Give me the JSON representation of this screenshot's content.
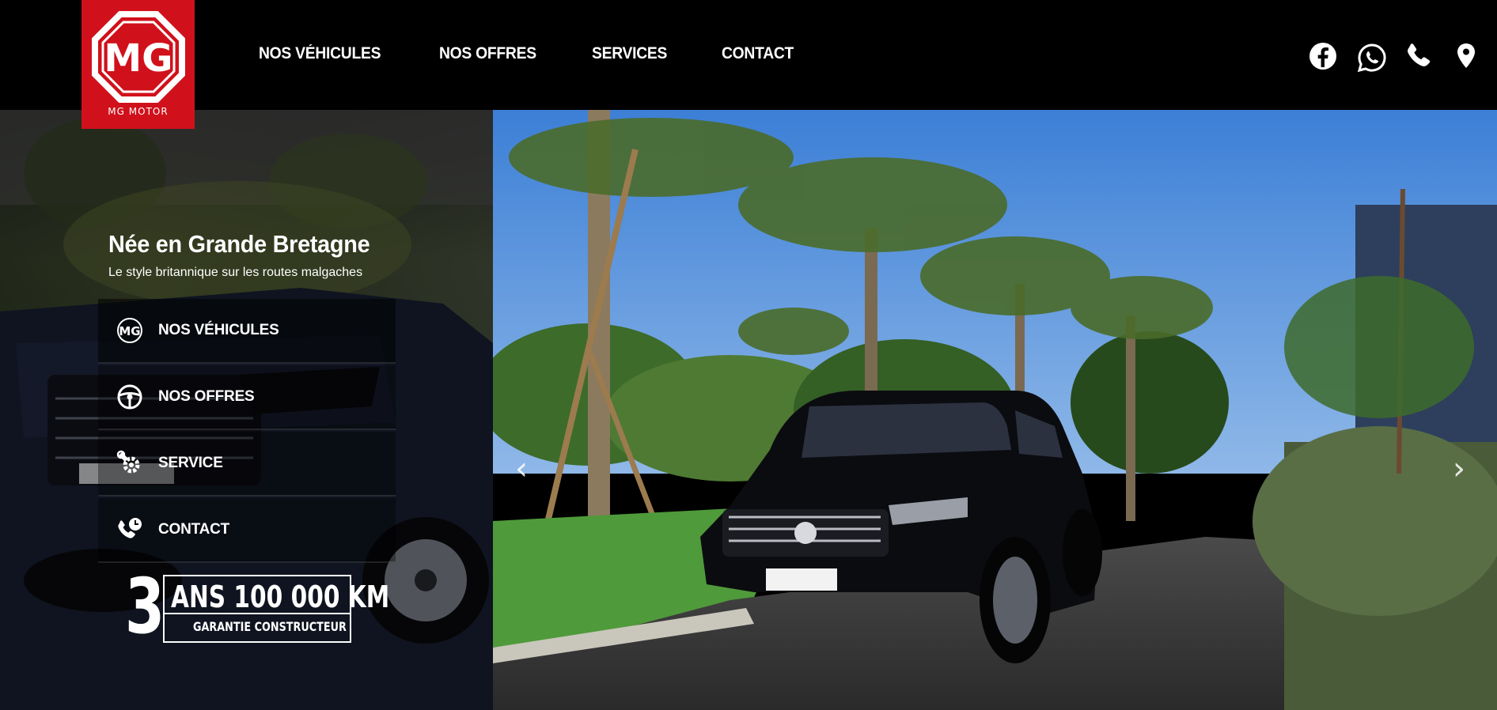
{
  "brand": {
    "name": "MG MOTOR",
    "logo_letters": "MG",
    "color": "#d0111b"
  },
  "nav": {
    "items": [
      {
        "label": "NOS VÉHICULES"
      },
      {
        "label": "NOS OFFRES"
      },
      {
        "label": "SERVICES"
      },
      {
        "label": "CONTACT"
      }
    ]
  },
  "social": [
    "facebook-icon",
    "whatsapp-icon",
    "phone-icon",
    "location-pin-icon"
  ],
  "hero": {
    "headline": "Née en Grande Bretagne",
    "subline": "Le style britannique sur les routes malgaches",
    "menu": [
      {
        "label": "NOS VÉHICULES",
        "icon": "mg-logo-icon"
      },
      {
        "label": "NOS OFFRES",
        "icon": "steering-wheel-icon"
      },
      {
        "label": "SERVICE",
        "icon": "service-gear-icon"
      },
      {
        "label": "CONTACT",
        "icon": "phone-clock-icon"
      }
    ],
    "warranty": {
      "years": "3",
      "line1": "ANS 100 000 KM",
      "line2": "GARANTIE CONSTRUCTEUR"
    }
  },
  "slider": {
    "prev": "‹",
    "next": "›"
  }
}
